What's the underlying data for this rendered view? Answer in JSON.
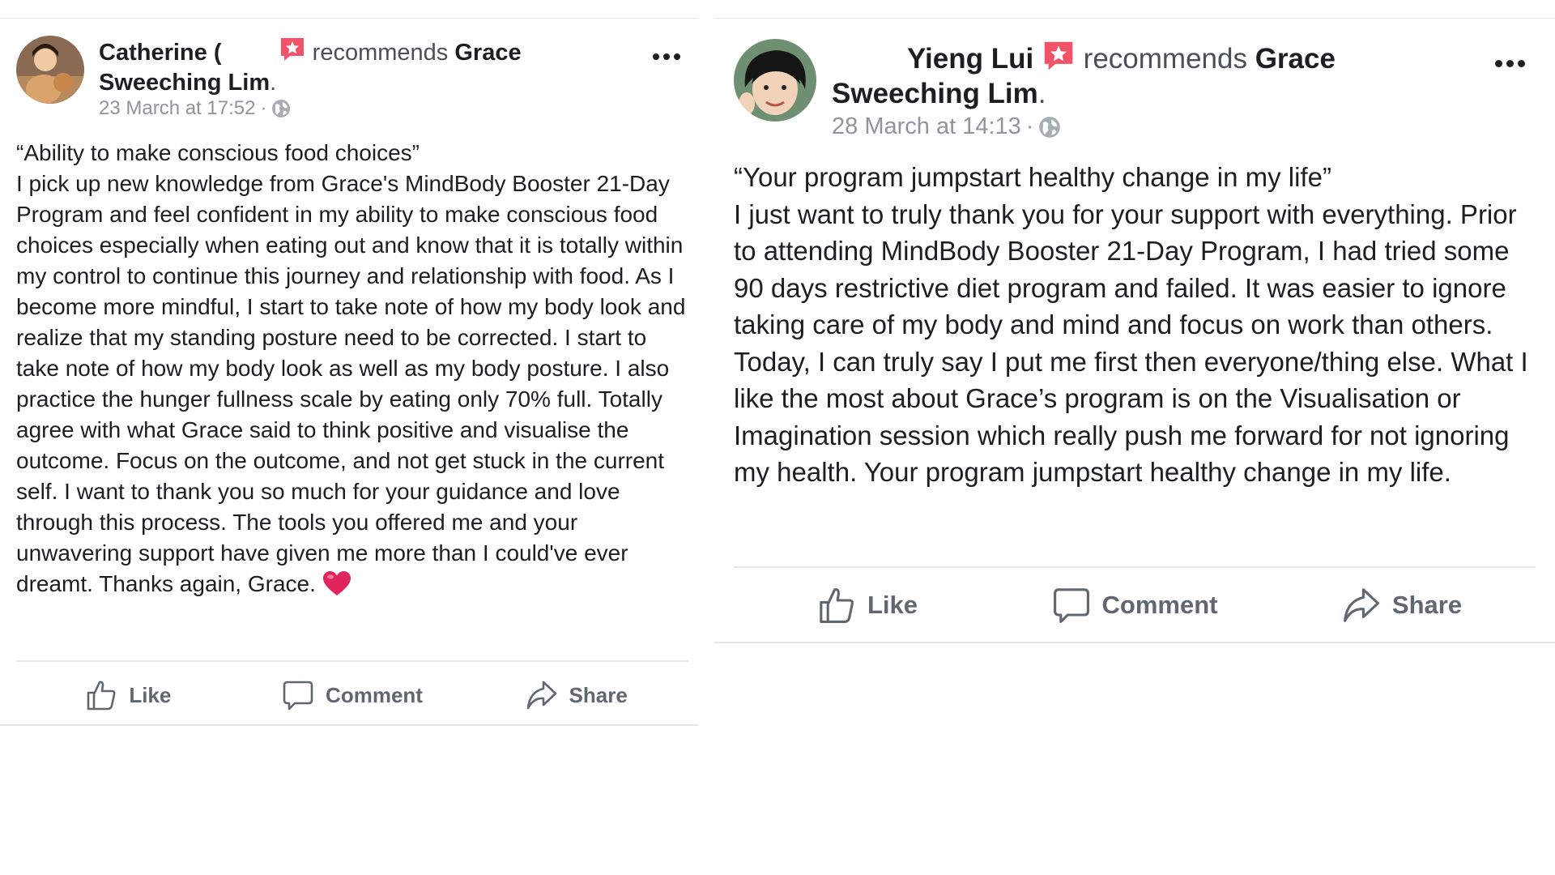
{
  "posts": [
    {
      "author": "Catherine (",
      "verb": "recommends",
      "target_line1": "Grace",
      "target_line2": "Sweeching Lim",
      "period": ".",
      "timestamp": "23 March at 17:52",
      "separator": "·",
      "quote": "“Ability to make conscious food choices”",
      "body": "I pick up new knowledge from Grace's MindBody Booster 21-Day Program and feel confident in my ability to make conscious food choices especially when eating out and know that it is totally within my control to continue this journey and relationship with food. As I become more mindful, I start to take note of how my body look and realize that my standing posture need to be corrected. I start to take note of how my body look as well as my body posture. I also practice the hunger fullness scale by eating only 70% full. Totally agree with what Grace said to think positive and visualise the outcome. Focus on the outcome, and not get stuck in the current self. I want to thank you so much for your guidance and love through this process. The tools you offered me and your unwavering support have given me more than I could've ever dreamt. Thanks again, Grace.",
      "actions": {
        "like": "Like",
        "comment": "Comment",
        "share": "Share"
      }
    },
    {
      "author": "Yieng Lui",
      "verb": "recommends",
      "target_line1": "Grace",
      "target_line2": "Sweeching Lim",
      "period": ".",
      "timestamp": "28 March at 14:13",
      "separator": "·",
      "quote": "“Your program jumpstart healthy change in my life”",
      "body": "I just want to truly thank you for your support with everything. Prior to attending MindBody Booster 21-Day Program, I had tried some 90 days restrictive diet program and failed. It was easier to ignore taking care of my body and mind and focus on work than others. Today, I can truly say I put me first then everyone/thing else. What I like the most about Grace’s program is on the Visualisation or Imagination session which really push me forward for not ignoring my health. Your program jumpstart healthy change in my life.",
      "actions": {
        "like": "Like",
        "comment": "Comment",
        "share": "Share"
      }
    }
  ],
  "colors": {
    "text": "#1c1e21",
    "secondary": "#90949c",
    "action": "#606770",
    "badge": "#f35369",
    "heart": "#e0245e",
    "divider": "#e4e6e9"
  }
}
